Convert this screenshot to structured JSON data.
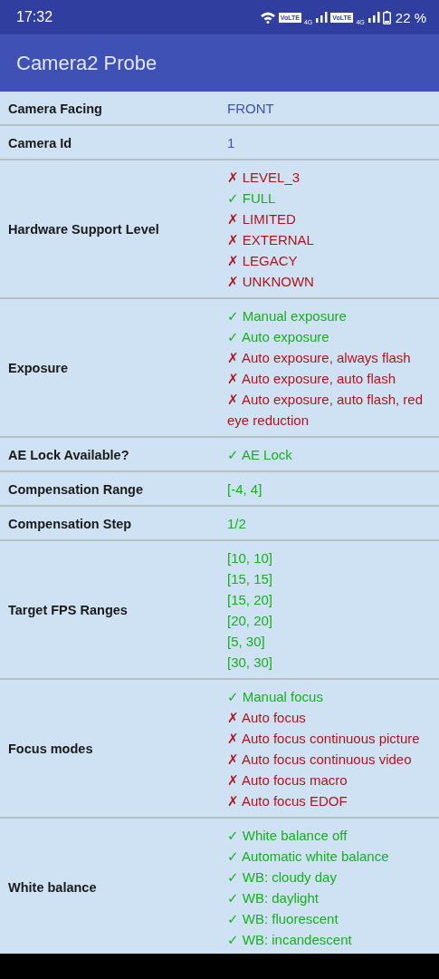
{
  "status_bar": {
    "time": "17:32",
    "sims": [
      {
        "volte": "VoLTE",
        "network": "4G"
      },
      {
        "volte": "VoLTE",
        "network": "4G"
      }
    ],
    "battery": "22 %"
  },
  "toolbar": {
    "title": "Camera2 Probe"
  },
  "rows": [
    {
      "label": "Camera Facing",
      "values": [
        {
          "kind": "info",
          "text": "FRONT"
        }
      ]
    },
    {
      "label": "Camera Id",
      "values": [
        {
          "kind": "info",
          "text": "1"
        }
      ]
    },
    {
      "label": "Hardware Support Level",
      "values": [
        {
          "kind": "result",
          "supported": false,
          "mark": "✗",
          "text": "LEVEL_3"
        },
        {
          "kind": "result",
          "supported": true,
          "mark": "✓",
          "text": "FULL"
        },
        {
          "kind": "result",
          "supported": false,
          "mark": "✗",
          "text": "LIMITED"
        },
        {
          "kind": "result",
          "supported": false,
          "mark": "✗",
          "text": "EXTERNAL"
        },
        {
          "kind": "result",
          "supported": false,
          "mark": "✗",
          "text": "LEGACY"
        },
        {
          "kind": "result",
          "supported": false,
          "mark": "✗",
          "text": "UNKNOWN"
        }
      ]
    },
    {
      "label": "Exposure",
      "values": [
        {
          "kind": "result",
          "supported": true,
          "mark": "✓",
          "text": "Manual exposure"
        },
        {
          "kind": "result",
          "supported": true,
          "mark": "✓",
          "text": "Auto exposure"
        },
        {
          "kind": "result",
          "supported": false,
          "mark": "✗",
          "text": "Auto exposure, always flash"
        },
        {
          "kind": "result",
          "supported": false,
          "mark": "✗",
          "text": "Auto exposure, auto flash"
        },
        {
          "kind": "result",
          "supported": false,
          "mark": "✗",
          "text": "Auto exposure, auto flash, red eye reduction"
        }
      ]
    },
    {
      "label": "AE Lock Available?",
      "values": [
        {
          "kind": "result",
          "supported": true,
          "mark": "✓",
          "text": "AE Lock"
        }
      ]
    },
    {
      "label": "Compensation Range",
      "values": [
        {
          "kind": "result",
          "supported": true,
          "text": "[-4, 4]"
        }
      ]
    },
    {
      "label": "Compensation Step",
      "values": [
        {
          "kind": "result",
          "supported": true,
          "text": "1/2"
        }
      ]
    },
    {
      "label": "Target FPS Ranges",
      "values": [
        {
          "kind": "result",
          "supported": true,
          "text": "[10, 10]"
        },
        {
          "kind": "result",
          "supported": true,
          "text": "[15, 15]"
        },
        {
          "kind": "result",
          "supported": true,
          "text": "[15, 20]"
        },
        {
          "kind": "result",
          "supported": true,
          "text": "[20, 20]"
        },
        {
          "kind": "result",
          "supported": true,
          "text": "[5, 30]"
        },
        {
          "kind": "result",
          "supported": true,
          "text": "[30, 30]"
        }
      ]
    },
    {
      "label": "Focus modes",
      "values": [
        {
          "kind": "result",
          "supported": true,
          "mark": "✓",
          "text": "Manual focus"
        },
        {
          "kind": "result",
          "supported": false,
          "mark": "✗",
          "text": "Auto focus"
        },
        {
          "kind": "result",
          "supported": false,
          "mark": "✗",
          "text": "Auto focus continuous picture"
        },
        {
          "kind": "result",
          "supported": false,
          "mark": "✗",
          "text": "Auto focus continuous video"
        },
        {
          "kind": "result",
          "supported": false,
          "mark": "✗",
          "text": "Auto focus macro"
        },
        {
          "kind": "result",
          "supported": false,
          "mark": "✗",
          "text": "Auto focus EDOF"
        }
      ]
    },
    {
      "label": "White balance",
      "values": [
        {
          "kind": "result",
          "supported": true,
          "mark": "✓",
          "text": "White balance off"
        },
        {
          "kind": "result",
          "supported": true,
          "mark": "✓",
          "text": "Automatic white balance"
        },
        {
          "kind": "result",
          "supported": true,
          "mark": "✓",
          "text": "WB: cloudy day"
        },
        {
          "kind": "result",
          "supported": true,
          "mark": "✓",
          "text": "WB: daylight"
        },
        {
          "kind": "result",
          "supported": true,
          "mark": "✓",
          "text": "WB: fluorescent"
        },
        {
          "kind": "result",
          "supported": true,
          "mark": "✓",
          "text": "WB: incandescent"
        }
      ]
    }
  ]
}
